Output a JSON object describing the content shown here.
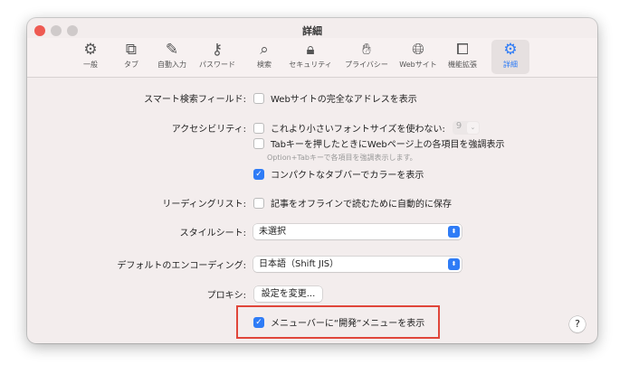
{
  "window": {
    "title": "詳細"
  },
  "toolbar": [
    {
      "label": "一般",
      "icon": "gear-icon",
      "glyph": "⚙"
    },
    {
      "label": "タブ",
      "icon": "tabs-icon",
      "glyph": "⧉"
    },
    {
      "label": "自動入力",
      "icon": "autofill-icon",
      "glyph": "✎"
    },
    {
      "label": "パスワード",
      "icon": "key-icon",
      "glyph": "⚷"
    },
    {
      "label": "検索",
      "icon": "search-icon",
      "glyph": "⌕"
    },
    {
      "label": "セキュリティ",
      "icon": "lock-icon",
      "glyph": "🔒︎"
    },
    {
      "label": "プライバシー",
      "icon": "hand-icon",
      "glyph": "✋︎"
    },
    {
      "label": "Webサイト",
      "icon": "globe-icon",
      "glyph": "🌐︎"
    },
    {
      "label": "機能拡張",
      "icon": "puzzle-icon",
      "glyph": "⧠"
    },
    {
      "label": "詳細",
      "icon": "gears-icon",
      "glyph": "⚙"
    }
  ],
  "settings": {
    "smart_search_label": "スマート検索フィールド:",
    "smart_search_option": "Webサイトの完全なアドレスを表示",
    "accessibility_label": "アクセシビリティ:",
    "min_font_option": "これより小さいフォントサイズを使わない:",
    "min_font_value": "9",
    "tab_option": "Tabキーを押したときにWebページ上の各項目を強調表示",
    "tab_hint": "Option+Tabキーで各項目を強調表示します。",
    "compact_option": "コンパクトなタブバーでカラーを表示",
    "reading_list_label": "リーディングリスト:",
    "reading_list_option": "記事をオフラインで読むために自動的に保存",
    "stylesheet_label": "スタイルシート:",
    "stylesheet_value": "未選択",
    "encoding_label": "デフォルトのエンコーディング:",
    "encoding_value": "日本語（Shift JIS）",
    "proxy_label": "プロキシ:",
    "proxy_button": "設定を変更...",
    "develop_menu_option": "メニューバーに“開発”メニューを表示",
    "help": "?"
  }
}
